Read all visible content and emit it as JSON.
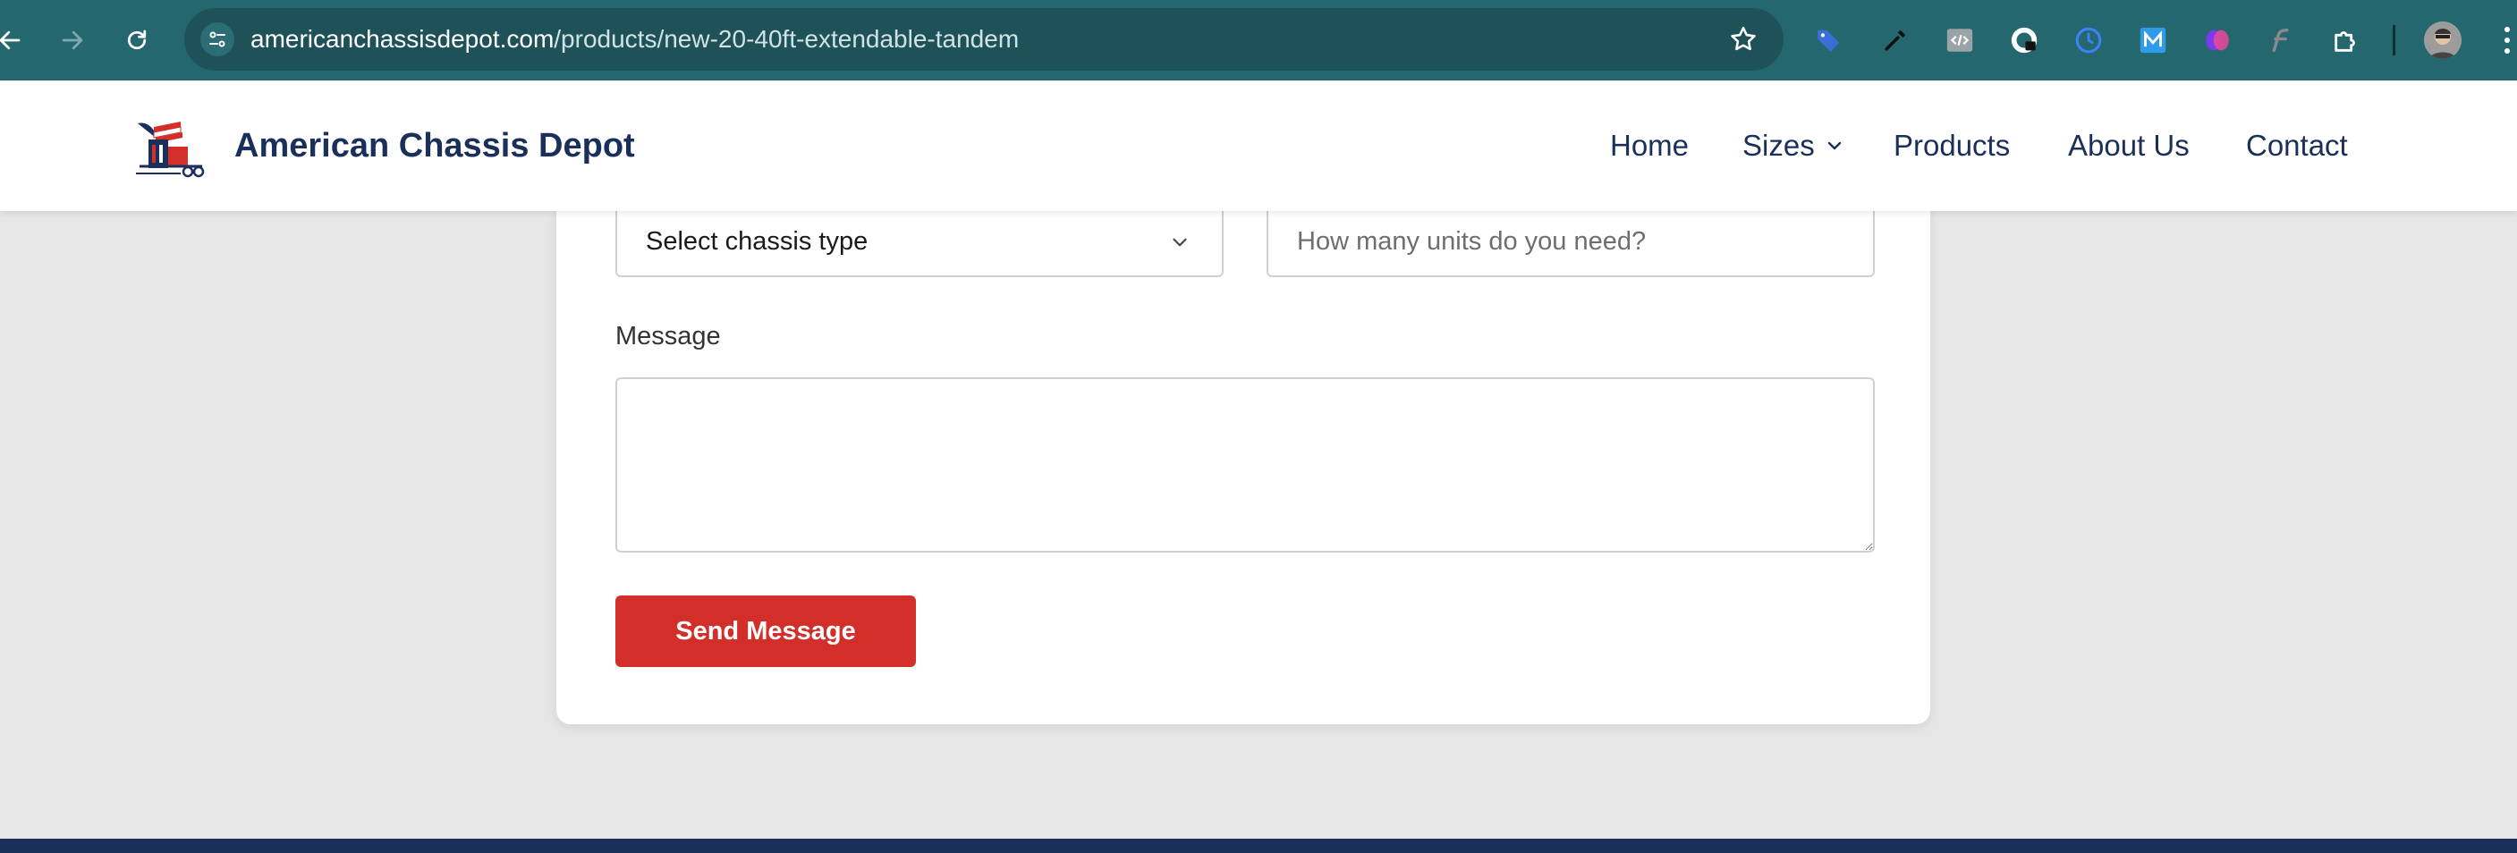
{
  "browser": {
    "url_host": "americanchassisdepot.com",
    "url_path": "/products/new-20-40ft-extendable-tandem",
    "extensions": [
      "tag-icon",
      "eyedropper-icon",
      "code-icon",
      "lock-extension-icon",
      "clock-icon",
      "m-icon",
      "brain-icon",
      "f-icon",
      "puzzle-icon"
    ]
  },
  "header": {
    "brand": "American Chassis Depot",
    "nav": {
      "home": "Home",
      "sizes": "Sizes",
      "products": "Products",
      "about": "About Us",
      "contact": "Contact"
    }
  },
  "form": {
    "chassis_type_selected": "Select chassis type",
    "units_placeholder": "How many units do you need?",
    "message_label": "Message",
    "message_value": "",
    "submit_label": "Send Message"
  },
  "colors": {
    "chrome": "#24676f",
    "brand_navy": "#1b2f5b",
    "accent_red": "#d32f2a",
    "page_bg": "#e6e6e6"
  }
}
